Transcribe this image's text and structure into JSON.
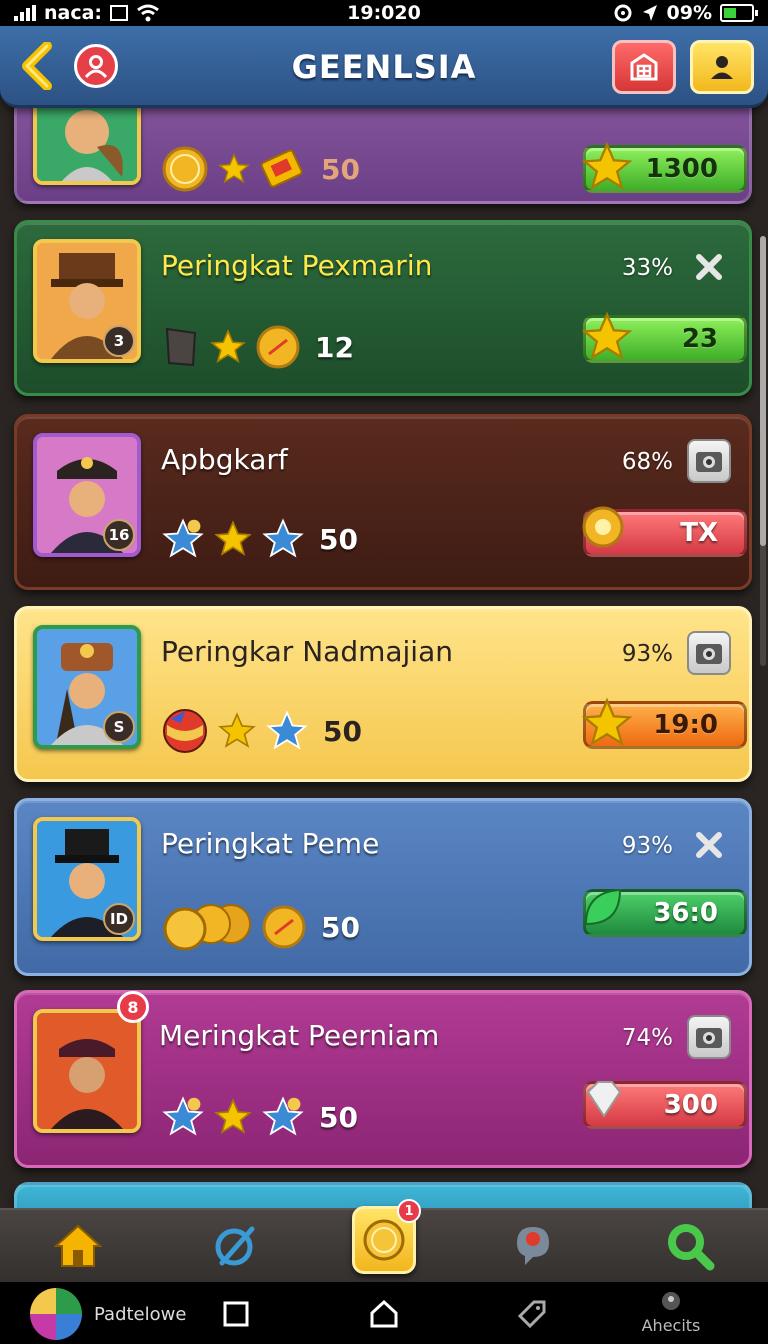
{
  "status_bar": {
    "carrier": "naca:",
    "time": "19:020",
    "battery": "09%"
  },
  "header": {
    "title": "GEENLSIA"
  },
  "ranks": [
    {
      "name": "",
      "percent": "",
      "reward_count": "50",
      "progress_label": "1300",
      "level": ""
    },
    {
      "name": "Peringkat Pexmarin",
      "percent": "33%",
      "reward_count": "12",
      "progress_label": "23",
      "level": "3"
    },
    {
      "name": "Apbgkarf",
      "percent": "68%",
      "reward_count": "50",
      "progress_label": "TX",
      "level": "16"
    },
    {
      "name": "Peringkar Nadmajian",
      "percent": "93%",
      "reward_count": "50",
      "progress_label": "19:0",
      "level": "S"
    },
    {
      "name": "Peringkat Peme",
      "percent": "93%",
      "reward_count": "50",
      "progress_label": "36:0",
      "level": "ID"
    },
    {
      "name": "Meringkat Peerniam",
      "percent": "74%",
      "reward_count": "50",
      "progress_label": "300",
      "level": "",
      "notification": "8"
    }
  ],
  "bottom_nav": {
    "center_badge": "1"
  },
  "system_bar": {
    "app_label": "Padtelowe",
    "right_label": "Ahecits"
  },
  "colors": {
    "header": "#3e6ea8",
    "accent_yellow": "#f2c94c",
    "progress_green": "#3fae2a",
    "progress_red": "#d53a44",
    "progress_orange": "#ee6a12"
  },
  "icons": [
    "back-chevron-icon",
    "profile-icon",
    "shop-icon",
    "user-icon",
    "coin-icon",
    "star-icon",
    "camera-icon",
    "close-icon",
    "home-icon",
    "chat-icon",
    "search-icon"
  ]
}
